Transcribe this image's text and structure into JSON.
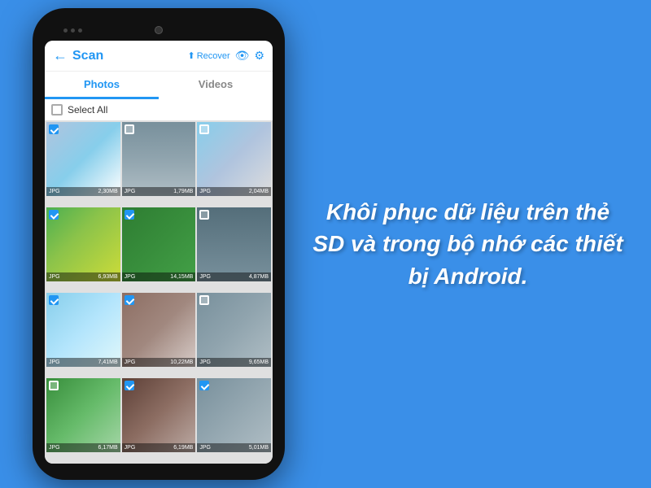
{
  "background_color": "#3a8fe8",
  "phone": {
    "app_bar": {
      "back_label": "←",
      "title": "Scan",
      "recover_label": "Recover",
      "icons": [
        "⬆",
        "👁",
        "⚙"
      ]
    },
    "tabs": [
      {
        "label": "Photos",
        "active": true
      },
      {
        "label": "Videos",
        "active": false
      }
    ],
    "select_all_label": "Select All",
    "photos": [
      {
        "type": "JPG",
        "size": "2,30MB",
        "checked": true,
        "color_class": "c1"
      },
      {
        "type": "JPG",
        "size": "1,79MB",
        "checked": false,
        "color_class": "c2"
      },
      {
        "type": "JPG",
        "size": "2,04MB",
        "checked": false,
        "color_class": "c3"
      },
      {
        "type": "JPG",
        "size": "6,93MB",
        "checked": true,
        "color_class": "c4"
      },
      {
        "type": "JPG",
        "size": "14,15MB",
        "checked": true,
        "color_class": "c5"
      },
      {
        "type": "JPG",
        "size": "4,87MB",
        "checked": false,
        "color_class": "c6"
      },
      {
        "type": "JPG",
        "size": "7,41MB",
        "checked": true,
        "color_class": "c7"
      },
      {
        "type": "JPG",
        "size": "10,22MB",
        "checked": true,
        "color_class": "c8"
      },
      {
        "type": "JPG",
        "size": "9,65MB",
        "checked": false,
        "color_class": "c9"
      },
      {
        "type": "JPG",
        "size": "6,17MB",
        "checked": false,
        "color_class": "c10"
      },
      {
        "type": "JPG",
        "size": "6,19MB",
        "checked": true,
        "color_class": "c11"
      },
      {
        "type": "JPG",
        "size": "5,01MB",
        "checked": true,
        "color_class": "c12"
      }
    ]
  },
  "right_text": "Khôi phục dữ liệu trên thẻ SD và trong bộ nhớ các thiết bị Android."
}
